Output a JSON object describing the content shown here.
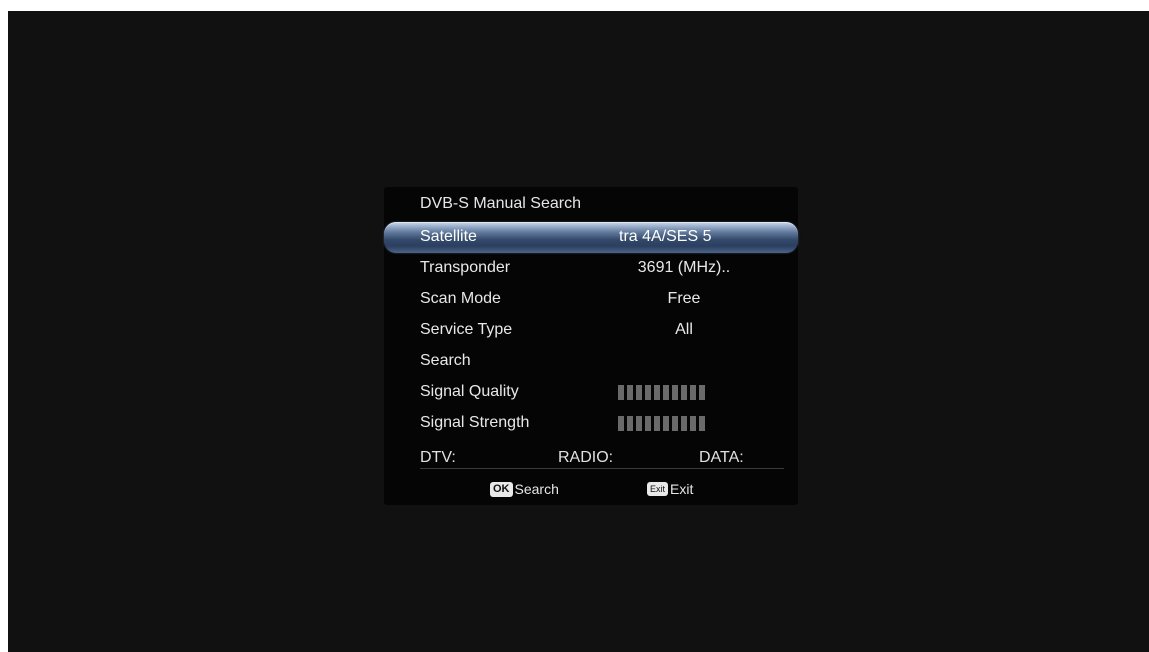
{
  "dialog": {
    "title": "DVB-S Manual Search",
    "rows": [
      {
        "label": "Satellite",
        "value": "tra 4A/SES 5"
      },
      {
        "label": "Transponder",
        "value": "3691 (MHz).."
      },
      {
        "label": "Scan Mode",
        "value": "Free"
      },
      {
        "label": "Service Type",
        "value": "All"
      },
      {
        "label": "Search",
        "value": ""
      },
      {
        "label": "Signal Quality",
        "value": ""
      },
      {
        "label": "Signal Strength",
        "value": ""
      }
    ],
    "selected_row": "Satellite",
    "signal_quality_level": 0,
    "signal_strength_level": 0,
    "signal_segments": 10,
    "counts": {
      "dtv_label": "DTV:",
      "radio_label": "RADIO:",
      "data_label": "DATA:"
    },
    "footer": {
      "ok_key": "OK",
      "ok_label": "Search",
      "exit_key": "Exit",
      "exit_label": "Exit"
    }
  },
  "colors": {
    "background": "#111111",
    "dialog": "#050505",
    "highlight": "#4b6487",
    "signal_bar": "#6a6a6a"
  }
}
